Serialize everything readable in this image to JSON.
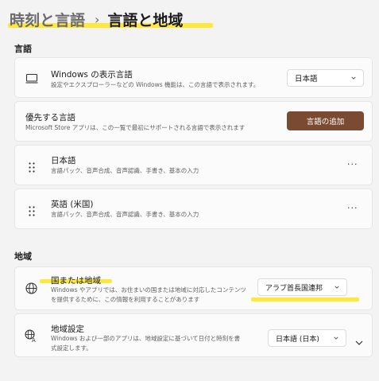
{
  "header": {
    "parent": "時刻と言語",
    "separator": "›",
    "current": "言語と地域"
  },
  "language_section": {
    "title": "言語",
    "display_language": {
      "title": "Windows の表示言語",
      "desc": "設定やエクスプローラーなどの Windows 機能は、この言語で表示されます。",
      "value": "日本語"
    },
    "preferred": {
      "title": "優先する言語",
      "desc": "Microsoft Store アプリは、この一覧で最初にサポートされる言語で表示されます",
      "add_button": "言語の追加"
    },
    "languages": [
      {
        "name": "日本語",
        "features": "言語パック、音声合成、音声認識、手書き、基本の入力",
        "more": "···"
      },
      {
        "name": "英語 (米国)",
        "features": "言語パック、音声合成、音声認識、手書き、基本の入力",
        "more": "···"
      }
    ]
  },
  "region_section": {
    "title": "地域",
    "country": {
      "title": "国または地域",
      "desc_line1": "Windows やアプリでは、お住まいの国または地域に対応したコンテンツ",
      "desc_line2": "を提供するために、この情報を利用することがあります",
      "value": "アラブ首長国連邦"
    },
    "format": {
      "title": "地域設定",
      "desc_line1": "Windows および一部のアプリは、地域設定に基づいて日付と時刻を書",
      "desc_line2": "式設定します。",
      "value": "日本語 (日本)"
    }
  },
  "colors": {
    "accent_button": "#7a4b32",
    "highlight": "#ffe83a",
    "background": "#f3f3f3",
    "card": "#fbfbfb"
  }
}
